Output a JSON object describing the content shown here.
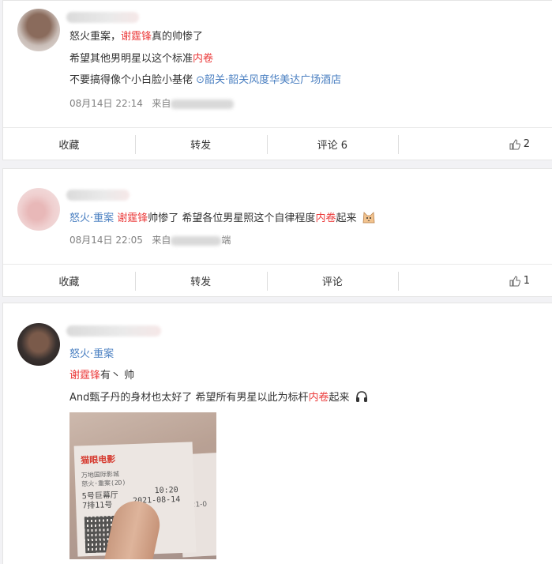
{
  "posts": [
    {
      "lines": [
        {
          "parts": [
            {
              "t": "怒火重案，",
              "c": ""
            },
            {
              "t": "谢霆锋",
              "c": "red"
            },
            {
              "t": "真的帅惨了",
              "c": ""
            }
          ]
        },
        {
          "parts": [
            {
              "t": "希望其他男明星以这个标准",
              "c": ""
            },
            {
              "t": "内卷",
              "c": "red"
            }
          ]
        },
        {
          "parts": [
            {
              "t": "不要搞得像个小白脸小基佬 ",
              "c": ""
            },
            {
              "t": "⊙韶关·韶关风度华美达广场酒店",
              "c": "link"
            }
          ]
        }
      ],
      "time": "08月14日 22:14",
      "source_prefix": "来自",
      "actions": {
        "collect": "收藏",
        "repost": "转发",
        "comment": "评论 6",
        "like": "2"
      }
    },
    {
      "lines": [
        {
          "parts": [
            {
              "t": "怒火·重案",
              "c": "link"
            },
            {
              "t": " ",
              "c": ""
            },
            {
              "t": "谢霆锋",
              "c": "red"
            },
            {
              "t": "帅惨了 希望各位男星照这个自律程度",
              "c": ""
            },
            {
              "t": "内卷",
              "c": "red"
            },
            {
              "t": "起来",
              "c": ""
            }
          ]
        }
      ],
      "time": "08月14日 22:05",
      "source_prefix": "来自",
      "source_suffix": "端",
      "actions": {
        "collect": "收藏",
        "repost": "转发",
        "comment": "评论",
        "like": "1"
      }
    },
    {
      "lines": [
        {
          "parts": [
            {
              "t": "怒火·重案",
              "c": "link"
            }
          ]
        },
        {
          "parts": [
            {
              "t": "谢霆锋",
              "c": "red"
            },
            {
              "t": "有丶 帅",
              "c": ""
            }
          ]
        },
        {
          "parts": [
            {
              "t": "And甄子丹的身材也太好了 希望所有男星以此为标杆",
              "c": ""
            },
            {
              "t": "内卷",
              "c": "red"
            },
            {
              "t": "起来",
              "c": ""
            }
          ]
        }
      ],
      "ticket": {
        "brand": "猫眼电影",
        "cinema": "万地国际影城",
        "movie": "怒火·重案(2D)",
        "hall": "5号巨幕厅",
        "seat": "7排11号",
        "time": "10:20",
        "date": "2021-08-14",
        "second_prefix": "021-0"
      }
    }
  ],
  "colors": {
    "highlight": "#eb3b3b",
    "link": "#4a7fc1",
    "meta": "#808080"
  }
}
